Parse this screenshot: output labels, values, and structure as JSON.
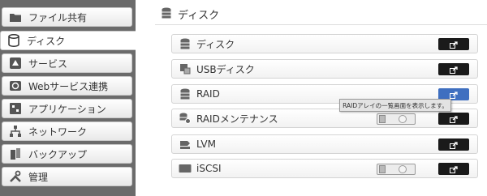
{
  "sidebar": {
    "items": [
      {
        "label": "ファイル共有",
        "icon": "folder-icon"
      },
      {
        "label": "ディスク",
        "icon": "disk-icon",
        "active": true
      },
      {
        "label": "サービス",
        "icon": "service-icon"
      },
      {
        "label": "Webサービス連携",
        "icon": "web-service-icon"
      },
      {
        "label": "アプリケーション",
        "icon": "application-icon"
      },
      {
        "label": "ネットワーク",
        "icon": "network-icon"
      },
      {
        "label": "バックアップ",
        "icon": "backup-icon"
      },
      {
        "label": "管理",
        "icon": "tools-icon"
      }
    ]
  },
  "header": {
    "title": "ディスク",
    "icon": "disk-stack-icon"
  },
  "rows": [
    {
      "label": "ディスク",
      "icon": "disk-icon"
    },
    {
      "label": "USBディスク",
      "icon": "usb-disk-icon"
    },
    {
      "label": "RAID",
      "icon": "raid-icon"
    },
    {
      "label": "RAIDメンテナンス",
      "icon": "raid-maintenance-icon"
    },
    {
      "label": "LVM",
      "icon": "lvm-icon"
    },
    {
      "label": "iSCSI",
      "icon": "iscsi-icon"
    }
  ],
  "tooltip": {
    "text": "RAIDアレイの一覧画面を表示します。"
  },
  "colors": {
    "sidebar_bg": "#6b6b6b",
    "button_bg": "#1a1a1a",
    "button_active": "#3f6fc0"
  }
}
